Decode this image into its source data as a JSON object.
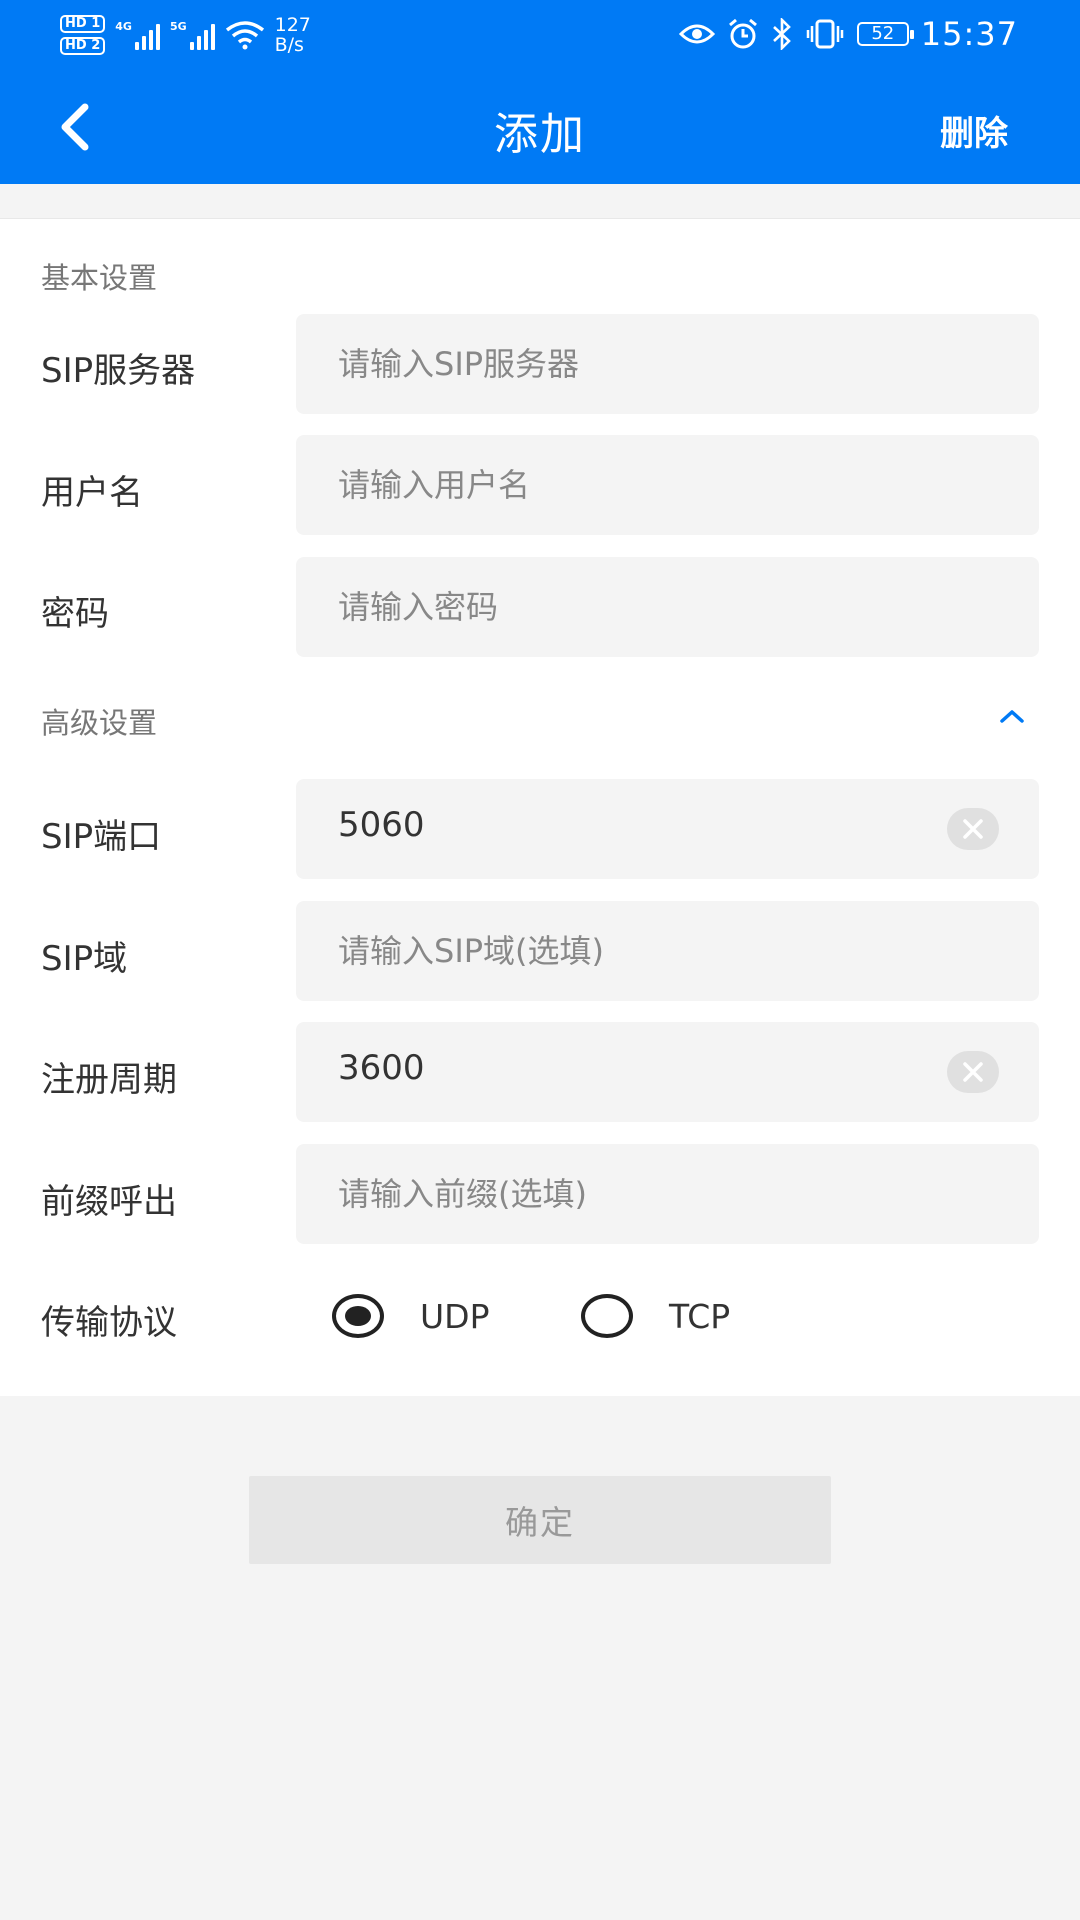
{
  "status_bar": {
    "sim1": "HD",
    "sim1_slot": "1",
    "sim2": "HD",
    "sim2_slot": "2",
    "network1": "4G",
    "network2": "5G",
    "speed_value": "127",
    "speed_unit": "B/s",
    "battery": "52",
    "time": "15:37"
  },
  "header": {
    "title": "添加",
    "action": "删除"
  },
  "sections": {
    "basic": "基本设置",
    "advanced": "高级设置"
  },
  "fields": {
    "sip_server": {
      "label": "SIP服务器",
      "placeholder": "请输入SIP服务器"
    },
    "username": {
      "label": "用户名",
      "placeholder": "请输入用户名"
    },
    "password": {
      "label": "密码",
      "placeholder": "请输入密码"
    },
    "sip_port": {
      "label": "SIP端口",
      "value": "5060"
    },
    "sip_domain": {
      "label": "SIP域",
      "placeholder": "请输入SIP域(选填)"
    },
    "register_period": {
      "label": "注册周期",
      "value": "3600"
    },
    "prefix_call": {
      "label": "前缀呼出",
      "placeholder": "请输入前缀(选填)"
    }
  },
  "transport": {
    "label": "传输协议",
    "options": [
      "UDP",
      "TCP"
    ],
    "selected": "UDP"
  },
  "confirm_label": "确定",
  "colors": {
    "primary": "#007af5",
    "background": "#f4f4f4",
    "field_bg": "#f4f4f4"
  }
}
